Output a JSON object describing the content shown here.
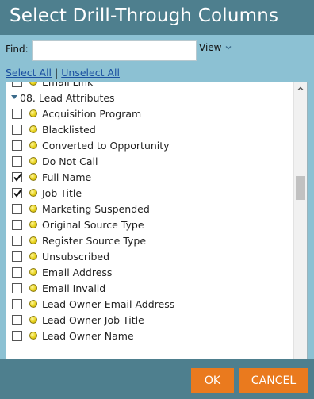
{
  "dialog": {
    "title": "Select Drill-Through Columns"
  },
  "find": {
    "label": "Find:",
    "value": "",
    "placeholder": ""
  },
  "view_menu": {
    "label": "View"
  },
  "links": {
    "select_all": "Select All",
    "separator": "|",
    "unselect_all": "Unselect All"
  },
  "list": {
    "items": [
      {
        "label": "Email Link",
        "checked": false,
        "type": "field"
      },
      {
        "label": "08. Lead Attributes",
        "type": "group"
      },
      {
        "label": "Acquisition Program",
        "checked": false,
        "type": "field"
      },
      {
        "label": "Blacklisted",
        "checked": false,
        "type": "field"
      },
      {
        "label": "Converted to Opportunity",
        "checked": false,
        "type": "field"
      },
      {
        "label": "Do Not Call",
        "checked": false,
        "type": "field"
      },
      {
        "label": "Full Name",
        "checked": true,
        "type": "field"
      },
      {
        "label": "Job Title",
        "checked": true,
        "type": "field"
      },
      {
        "label": "Marketing Suspended",
        "checked": false,
        "type": "field"
      },
      {
        "label": "Original Source Type",
        "checked": false,
        "type": "field"
      },
      {
        "label": "Register Source Type",
        "checked": false,
        "type": "field"
      },
      {
        "label": "Unsubscribed",
        "checked": false,
        "type": "field"
      },
      {
        "label": "Email Address",
        "checked": false,
        "type": "field"
      },
      {
        "label": "Email Invalid",
        "checked": false,
        "type": "field"
      },
      {
        "label": "Lead Owner Email Address",
        "checked": false,
        "type": "field"
      },
      {
        "label": "Lead Owner Job Title",
        "checked": false,
        "type": "field"
      },
      {
        "label": "Lead Owner Name",
        "checked": false,
        "type": "field"
      }
    ]
  },
  "buttons": {
    "ok": "OK",
    "cancel": "CANCEL"
  },
  "colors": {
    "title_bar": "#4e7f8e",
    "body_panel": "#8cc1d3",
    "button": "#ea7a1e",
    "link": "#1a4fa0"
  }
}
